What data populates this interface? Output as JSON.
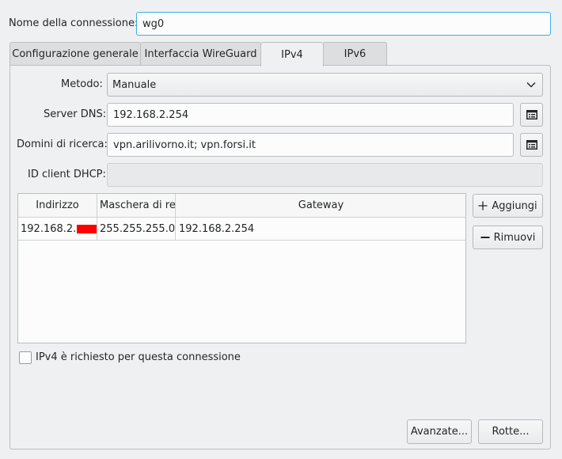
{
  "connection_name": {
    "label": "Nome della connessione:",
    "value": "wg0"
  },
  "tabs": [
    {
      "label": "Configurazione generale"
    },
    {
      "label": "Interfaccia WireGuard"
    },
    {
      "label": "IPv4",
      "active": true
    },
    {
      "label": "IPv6"
    }
  ],
  "ipv4": {
    "method": {
      "label": "Metodo:",
      "value": "Manuale"
    },
    "dns": {
      "label": "Server DNS:",
      "value": "192.168.2.254"
    },
    "search_domains": {
      "label": "Domini di ricerca:",
      "value": "vpn.arilivorno.it; vpn.forsi.it"
    },
    "dhcp_client_id": {
      "label": "ID client DHCP:",
      "value": ""
    },
    "addresses": {
      "columns": [
        "Indirizzo",
        "Maschera di ret",
        "Gateway"
      ],
      "rows": [
        {
          "address": "192.168.2.",
          "netmask": "255.255.255.0",
          "gateway": "192.168.2.254"
        }
      ]
    },
    "add_label": "Aggiungi",
    "remove_label": "Rimuovi",
    "required": {
      "label": "IPv4 è richiesto per questa connessione",
      "checked": false
    },
    "advanced_label": "Avanzate...",
    "routes_label": "Rotte..."
  },
  "colors": {
    "accent": "#3daee9",
    "redaction": "#ff0000"
  }
}
